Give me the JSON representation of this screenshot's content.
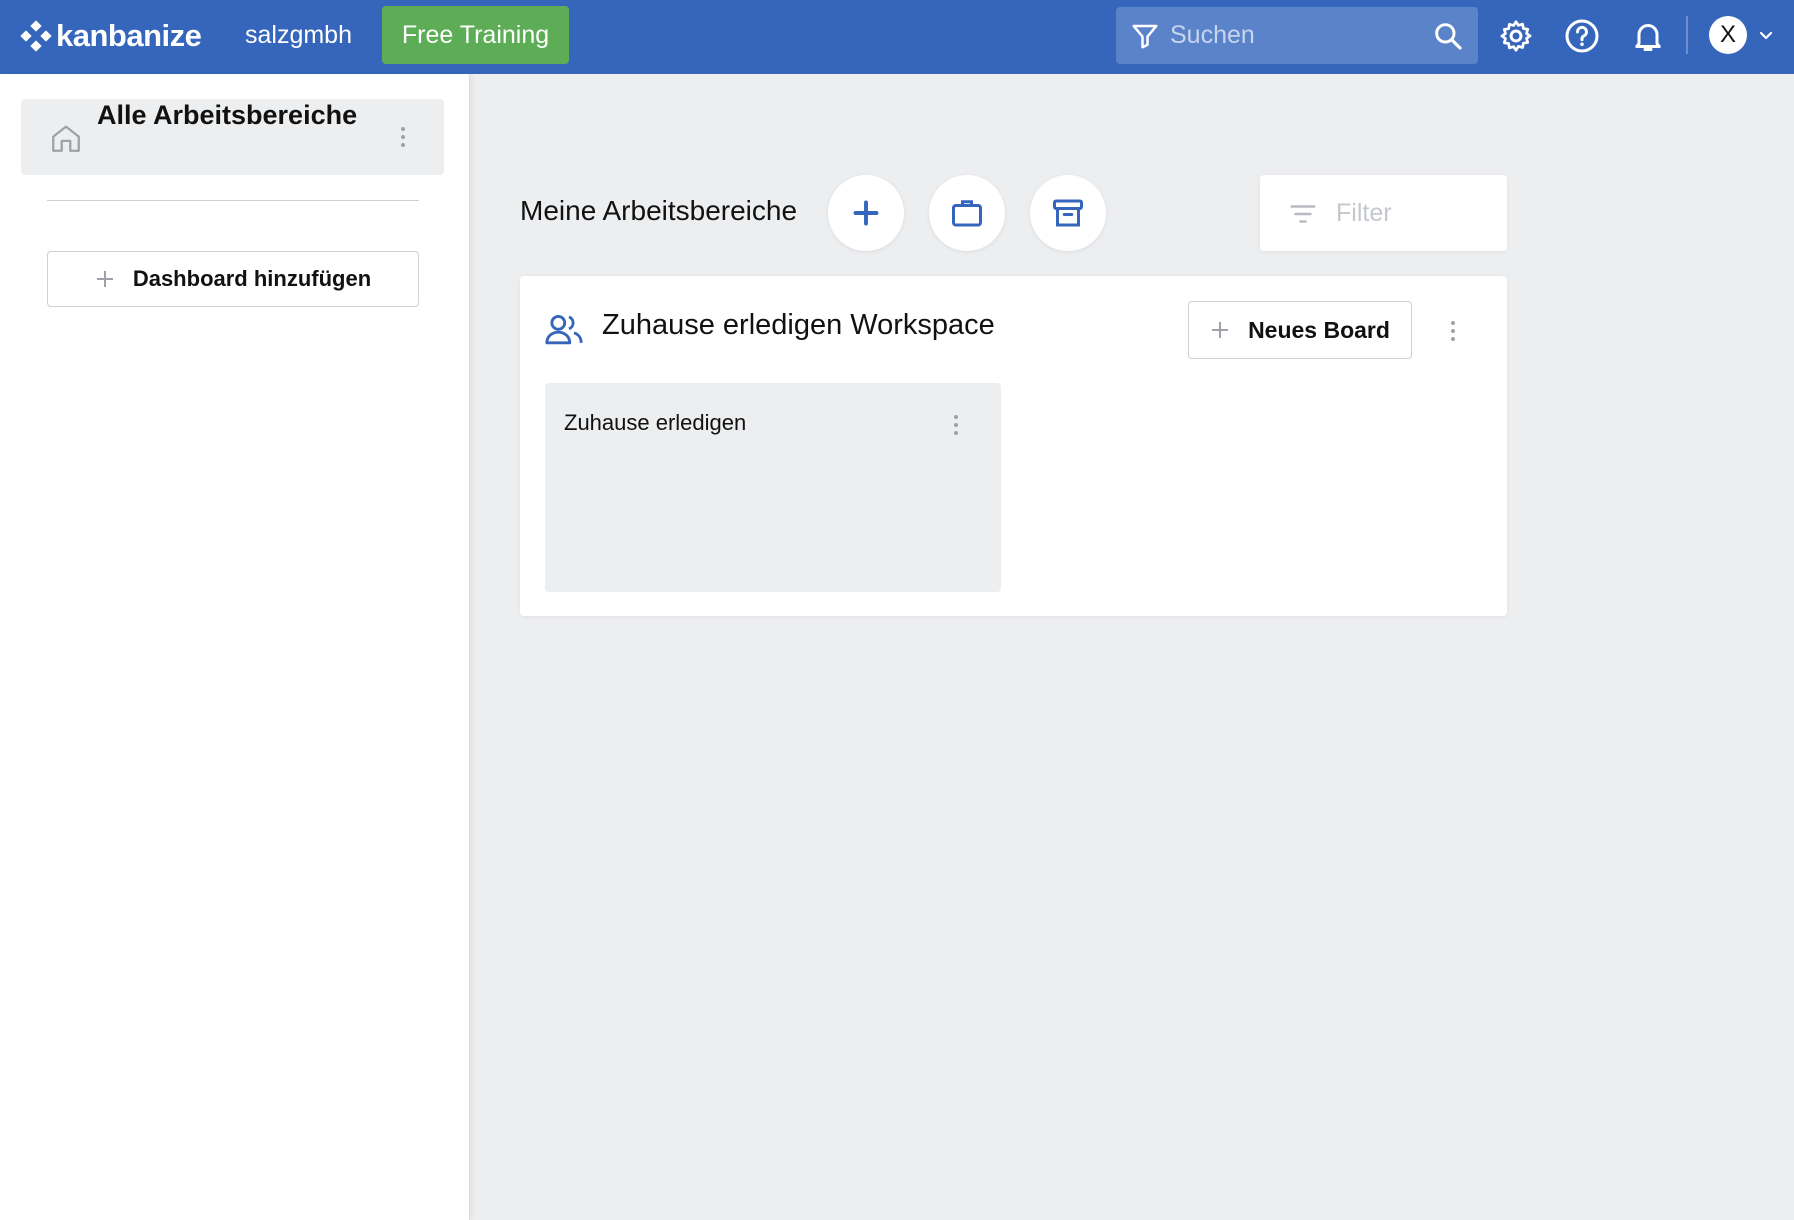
{
  "topbar": {
    "logo_text": "kanbanize",
    "org_name": "salzgmbh",
    "training_label": "Free Training",
    "search_placeholder": "Suchen",
    "user_initial": "X"
  },
  "sidebar": {
    "home_label": "Alle Arbeitsbereiche",
    "add_dashboard_label": "Dashboard hinzufügen"
  },
  "main": {
    "title": "Meine Arbeitsbereiche",
    "filter_placeholder": "Filter",
    "workspace": {
      "title": "Zuhause erledigen Workspace",
      "new_board_label": "Neues Board",
      "boards": [
        {
          "name": "Zuhause erledigen"
        }
      ]
    }
  },
  "colors": {
    "topbar": "#3566bb",
    "accent_blue": "#3566bb",
    "training_green": "#5cad55",
    "background": "#edeef0"
  },
  "icons": [
    "kanbanize-logo-icon",
    "filter-funnel-icon",
    "search-icon",
    "gear-icon",
    "help-icon",
    "bell-icon",
    "chevron-down-icon",
    "home-icon",
    "kebab-icon",
    "plus-icon",
    "briefcase-icon",
    "archive-icon",
    "filter-lines-icon",
    "people-icon"
  ]
}
